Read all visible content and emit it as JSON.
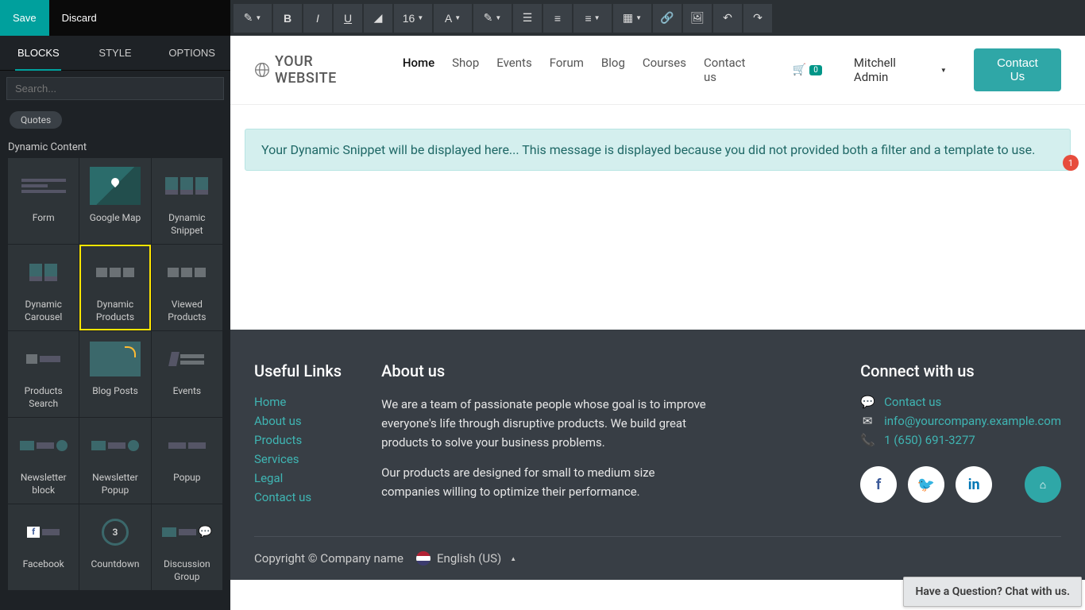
{
  "toolbar": {
    "save": "Save",
    "discard": "Discard",
    "font_size": "16"
  },
  "sidebar": {
    "tabs": {
      "blocks": "BLOCKS",
      "style": "STYLE",
      "options": "OPTIONS"
    },
    "search_placeholder": "Search...",
    "prev_category_item": "Quotes",
    "section_title": "Dynamic Content",
    "blocks": [
      {
        "label": "Form"
      },
      {
        "label": "Google Map"
      },
      {
        "label": "Dynamic Snippet"
      },
      {
        "label": "Dynamic Carousel"
      },
      {
        "label": "Dynamic Products",
        "highlight": true
      },
      {
        "label": "Viewed Products"
      },
      {
        "label": "Products Search"
      },
      {
        "label": "Blog Posts"
      },
      {
        "label": "Events"
      },
      {
        "label": "Newsletter block"
      },
      {
        "label": "Newsletter Popup"
      },
      {
        "label": "Popup"
      },
      {
        "label": "Facebook"
      },
      {
        "label": "Countdown"
      },
      {
        "label": "Discussion Group"
      }
    ]
  },
  "site": {
    "logo_text": "YOUR WEBSITE",
    "nav": [
      "Home",
      "Shop",
      "Events",
      "Forum",
      "Blog",
      "Courses",
      "Contact us"
    ],
    "active_nav": "Home",
    "cart_count": "0",
    "user": "Mitchell Admin",
    "contact_btn": "Contact Us",
    "snippet_message": "Your Dynamic Snippet will be displayed here... This message is displayed because you did not provided both a filter and a template to use.",
    "notif_count": "1"
  },
  "footer": {
    "useful_title": "Useful Links",
    "useful_links": [
      "Home",
      "About us",
      "Products",
      "Services",
      "Legal",
      "Contact us"
    ],
    "about_title": "About us",
    "about_p1": "We are a team of passionate people whose goal is to improve everyone's life through disruptive products. We build great products to solve your business problems.",
    "about_p2": "Our products are designed for small to medium size companies willing to optimize their performance.",
    "connect_title": "Connect with us",
    "connect_contact": "Contact us",
    "connect_email": "info@yourcompany.example.com",
    "connect_phone": "1 (650) 691-3277",
    "copyright": "Copyright © Company name",
    "language": "English (US)"
  },
  "chat": {
    "text": "Have a Question? Chat with us."
  }
}
